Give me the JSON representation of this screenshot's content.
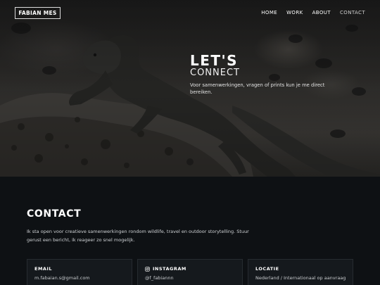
{
  "brand": {
    "name": "FABIAN MES"
  },
  "nav": {
    "items": [
      {
        "label": "HOME"
      },
      {
        "label": "WORK"
      },
      {
        "label": "ABOUT"
      },
      {
        "label": "CONTACT"
      }
    ]
  },
  "hero": {
    "title": "LET'S",
    "subtitle": "CONNECT",
    "text": "Voor samenwerkingen, vragen of prints kun je me direct bereiken."
  },
  "contact": {
    "title": "CONTACT",
    "intro": "Ik sta open voor creatieve samenwerkingen rondom wildlife, travel en outdoor storytelling. Stuur gerust een bericht, ik reageer zo snel mogelijk.",
    "cards": [
      {
        "label": "EMAIL",
        "value": "m.fabaian.s@gmail.com",
        "icon": ""
      },
      {
        "label": "INSTAGRAM",
        "value": "@f_fabiannn",
        "icon": "instagram-icon"
      },
      {
        "label": "LOCATIE",
        "value": "Nederland / Internationaal op aanvraag",
        "icon": ""
      }
    ]
  },
  "colors": {
    "background": "#0e1114",
    "card": "#15191d",
    "text": "#ffffff"
  }
}
